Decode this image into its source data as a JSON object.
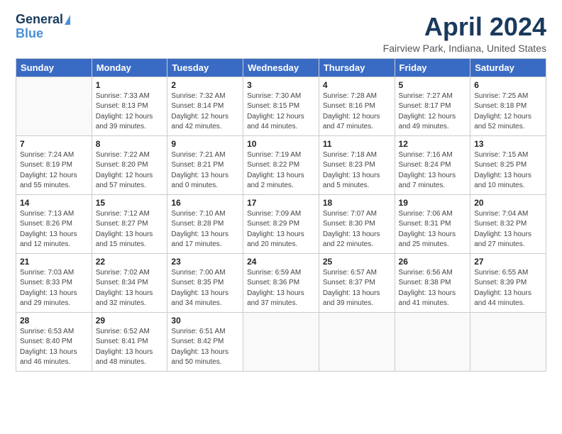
{
  "logo": {
    "line1": "General",
    "line2": "Blue"
  },
  "title": "April 2024",
  "subtitle": "Fairview Park, Indiana, United States",
  "days_header": [
    "Sunday",
    "Monday",
    "Tuesday",
    "Wednesday",
    "Thursday",
    "Friday",
    "Saturday"
  ],
  "weeks": [
    [
      {
        "num": "",
        "detail": ""
      },
      {
        "num": "1",
        "detail": "Sunrise: 7:33 AM\nSunset: 8:13 PM\nDaylight: 12 hours\nand 39 minutes."
      },
      {
        "num": "2",
        "detail": "Sunrise: 7:32 AM\nSunset: 8:14 PM\nDaylight: 12 hours\nand 42 minutes."
      },
      {
        "num": "3",
        "detail": "Sunrise: 7:30 AM\nSunset: 8:15 PM\nDaylight: 12 hours\nand 44 minutes."
      },
      {
        "num": "4",
        "detail": "Sunrise: 7:28 AM\nSunset: 8:16 PM\nDaylight: 12 hours\nand 47 minutes."
      },
      {
        "num": "5",
        "detail": "Sunrise: 7:27 AM\nSunset: 8:17 PM\nDaylight: 12 hours\nand 49 minutes."
      },
      {
        "num": "6",
        "detail": "Sunrise: 7:25 AM\nSunset: 8:18 PM\nDaylight: 12 hours\nand 52 minutes."
      }
    ],
    [
      {
        "num": "7",
        "detail": "Sunrise: 7:24 AM\nSunset: 8:19 PM\nDaylight: 12 hours\nand 55 minutes."
      },
      {
        "num": "8",
        "detail": "Sunrise: 7:22 AM\nSunset: 8:20 PM\nDaylight: 12 hours\nand 57 minutes."
      },
      {
        "num": "9",
        "detail": "Sunrise: 7:21 AM\nSunset: 8:21 PM\nDaylight: 13 hours\nand 0 minutes."
      },
      {
        "num": "10",
        "detail": "Sunrise: 7:19 AM\nSunset: 8:22 PM\nDaylight: 13 hours\nand 2 minutes."
      },
      {
        "num": "11",
        "detail": "Sunrise: 7:18 AM\nSunset: 8:23 PM\nDaylight: 13 hours\nand 5 minutes."
      },
      {
        "num": "12",
        "detail": "Sunrise: 7:16 AM\nSunset: 8:24 PM\nDaylight: 13 hours\nand 7 minutes."
      },
      {
        "num": "13",
        "detail": "Sunrise: 7:15 AM\nSunset: 8:25 PM\nDaylight: 13 hours\nand 10 minutes."
      }
    ],
    [
      {
        "num": "14",
        "detail": "Sunrise: 7:13 AM\nSunset: 8:26 PM\nDaylight: 13 hours\nand 12 minutes."
      },
      {
        "num": "15",
        "detail": "Sunrise: 7:12 AM\nSunset: 8:27 PM\nDaylight: 13 hours\nand 15 minutes."
      },
      {
        "num": "16",
        "detail": "Sunrise: 7:10 AM\nSunset: 8:28 PM\nDaylight: 13 hours\nand 17 minutes."
      },
      {
        "num": "17",
        "detail": "Sunrise: 7:09 AM\nSunset: 8:29 PM\nDaylight: 13 hours\nand 20 minutes."
      },
      {
        "num": "18",
        "detail": "Sunrise: 7:07 AM\nSunset: 8:30 PM\nDaylight: 13 hours\nand 22 minutes."
      },
      {
        "num": "19",
        "detail": "Sunrise: 7:06 AM\nSunset: 8:31 PM\nDaylight: 13 hours\nand 25 minutes."
      },
      {
        "num": "20",
        "detail": "Sunrise: 7:04 AM\nSunset: 8:32 PM\nDaylight: 13 hours\nand 27 minutes."
      }
    ],
    [
      {
        "num": "21",
        "detail": "Sunrise: 7:03 AM\nSunset: 8:33 PM\nDaylight: 13 hours\nand 29 minutes."
      },
      {
        "num": "22",
        "detail": "Sunrise: 7:02 AM\nSunset: 8:34 PM\nDaylight: 13 hours\nand 32 minutes."
      },
      {
        "num": "23",
        "detail": "Sunrise: 7:00 AM\nSunset: 8:35 PM\nDaylight: 13 hours\nand 34 minutes."
      },
      {
        "num": "24",
        "detail": "Sunrise: 6:59 AM\nSunset: 8:36 PM\nDaylight: 13 hours\nand 37 minutes."
      },
      {
        "num": "25",
        "detail": "Sunrise: 6:57 AM\nSunset: 8:37 PM\nDaylight: 13 hours\nand 39 minutes."
      },
      {
        "num": "26",
        "detail": "Sunrise: 6:56 AM\nSunset: 8:38 PM\nDaylight: 13 hours\nand 41 minutes."
      },
      {
        "num": "27",
        "detail": "Sunrise: 6:55 AM\nSunset: 8:39 PM\nDaylight: 13 hours\nand 44 minutes."
      }
    ],
    [
      {
        "num": "28",
        "detail": "Sunrise: 6:53 AM\nSunset: 8:40 PM\nDaylight: 13 hours\nand 46 minutes."
      },
      {
        "num": "29",
        "detail": "Sunrise: 6:52 AM\nSunset: 8:41 PM\nDaylight: 13 hours\nand 48 minutes."
      },
      {
        "num": "30",
        "detail": "Sunrise: 6:51 AM\nSunset: 8:42 PM\nDaylight: 13 hours\nand 50 minutes."
      },
      {
        "num": "",
        "detail": ""
      },
      {
        "num": "",
        "detail": ""
      },
      {
        "num": "",
        "detail": ""
      },
      {
        "num": "",
        "detail": ""
      }
    ]
  ]
}
